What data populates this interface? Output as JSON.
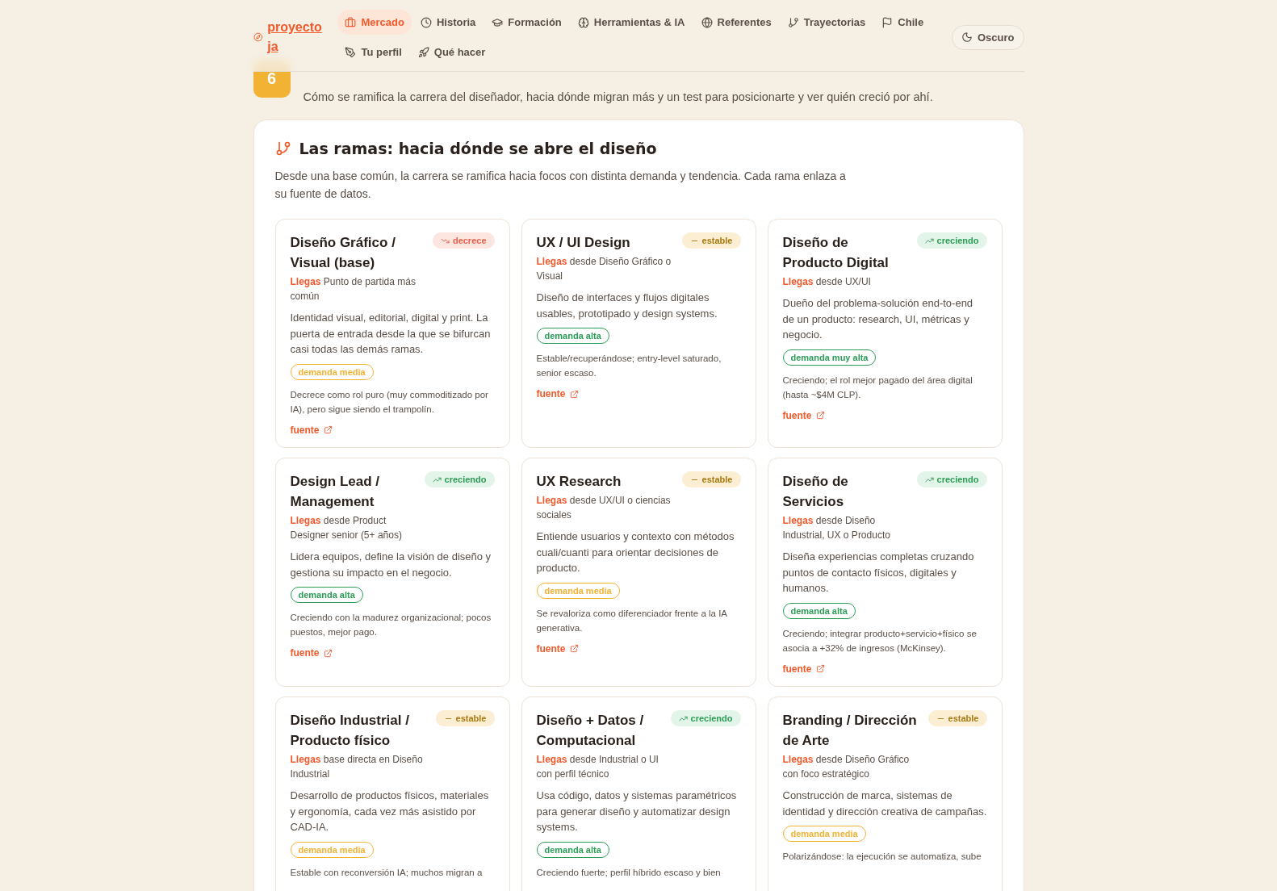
{
  "logo": {
    "text": "proyecto ja"
  },
  "nav": {
    "items": [
      {
        "label": "Mercado",
        "selected": true
      },
      {
        "label": "Historia",
        "selected": false
      },
      {
        "label": "Formación",
        "selected": false
      },
      {
        "label": "Herramientas & IA",
        "selected": false
      },
      {
        "label": "Referentes",
        "selected": false
      },
      {
        "label": "Trayectorias",
        "selected": false
      },
      {
        "label": "Chile",
        "selected": false
      },
      {
        "label": "Tu perfil",
        "selected": false
      },
      {
        "label": "Qué hacer",
        "selected": false
      }
    ],
    "theme_button": "Oscuro"
  },
  "section": {
    "number": "6",
    "subtitle": "Cómo se ramifica la carrera del diseñador, hacia dónde migran más y un test para posicionarte y ver quién creció por ahí."
  },
  "panel": {
    "title": "Las ramas: hacia dónde se abre el diseño",
    "description": "Desde una base común, la carrera se ramifica hacia focos con distinta demanda y tendencia. Cada rama enlaza a su fuente de datos.",
    "cards": [
      {
        "title": "Diseño Gráfico / Visual (base)",
        "trend": {
          "kind": "down",
          "label": "decrece"
        },
        "from_label": "Llegas",
        "from": "Punto de partida más común",
        "description": "Identidad visual, editorial, digital y print. La puerta de entrada desde la que se bifurcan casi todas las demás ramas.",
        "demand": {
          "kind": "medium",
          "label": "demanda media"
        },
        "note": "Decrece como rol puro (muy commoditizado por IA), pero sigue siendo el trampolín.",
        "link": "fuente"
      },
      {
        "title": "UX / UI Design",
        "trend": {
          "kind": "flat",
          "label": "estable"
        },
        "from_label": "Llegas",
        "from": "desde Diseño Gráfico o Visual",
        "description": "Diseño de interfaces y flujos digitales usables, prototipado y design systems.",
        "demand": {
          "kind": "high",
          "label": "demanda alta"
        },
        "note": "Estable/recuperándose; entry-level saturado, senior escaso.",
        "link": "fuente"
      },
      {
        "title": "Diseño de Producto Digital",
        "trend": {
          "kind": "up",
          "label": "creciendo"
        },
        "from_label": "Llegas",
        "from": "desde UX/UI",
        "description": "Dueño del problema-solución end-to-end de un producto: research, UI, métricas y negocio.",
        "demand": {
          "kind": "high",
          "label": "demanda muy alta"
        },
        "note": "Creciendo; el rol mejor pagado del área digital (hasta ~$4M CLP).",
        "link": "fuente"
      },
      {
        "title": "Design Lead / Management",
        "trend": {
          "kind": "up",
          "label": "creciendo"
        },
        "from_label": "Llegas",
        "from": "desde Product Designer senior (5+ años)",
        "description": "Lidera equipos, define la visión de diseño y gestiona su impacto en el negocio.",
        "demand": {
          "kind": "high",
          "label": "demanda alta"
        },
        "note": "Creciendo con la madurez organizacional; pocos puestos, mejor pago.",
        "link": "fuente"
      },
      {
        "title": "UX Research",
        "trend": {
          "kind": "flat",
          "label": "estable"
        },
        "from_label": "Llegas",
        "from": "desde UX/UI o ciencias sociales",
        "description": "Entiende usuarios y contexto con métodos cuali/cuanti para orientar decisiones de producto.",
        "demand": {
          "kind": "medium",
          "label": "demanda media"
        },
        "note": "Se revaloriza como diferenciador frente a la IA generativa.",
        "link": "fuente"
      },
      {
        "title": "Diseño de Servicios",
        "trend": {
          "kind": "up",
          "label": "creciendo"
        },
        "from_label": "Llegas",
        "from": "desde Diseño Industrial, UX o Producto",
        "description": "Diseña experiencias completas cruzando puntos de contacto físicos, digitales y humanos.",
        "demand": {
          "kind": "high",
          "label": "demanda alta"
        },
        "note": "Creciendo; integrar producto+servicio+físico se asocia a +32% de ingresos (McKinsey).",
        "link": "fuente"
      },
      {
        "title": "Diseño Industrial / Producto físico",
        "trend": {
          "kind": "flat",
          "label": "estable"
        },
        "from_label": "Llegas",
        "from": "base directa en Diseño Industrial",
        "description": "Desarrollo de productos físicos, materiales y ergonomía, cada vez más asistido por CAD-IA.",
        "demand": {
          "kind": "medium",
          "label": "demanda media"
        },
        "note": "Estable con reconversión IA; muchos migran a"
      },
      {
        "title": "Diseño + Datos / Computacional",
        "trend": {
          "kind": "up",
          "label": "creciendo"
        },
        "from_label": "Llegas",
        "from": "desde Industrial o UI con perfil técnico",
        "description": "Usa código, datos y sistemas paramétricos para generar diseño y automatizar design systems.",
        "demand": {
          "kind": "high",
          "label": "demanda alta"
        },
        "note": "Creciendo fuerte; perfil híbrido escaso y bien"
      },
      {
        "title": "Branding / Dirección de Arte",
        "trend": {
          "kind": "flat",
          "label": "estable"
        },
        "from_label": "Llegas",
        "from": "desde Diseño Gráfico con foco estratégico",
        "description": "Construcción de marca, sistemas de identidad y dirección creativa de campañas.",
        "demand": {
          "kind": "medium",
          "label": "demanda media"
        },
        "note": "Polarizándose: la ejecución se automatiza, sube"
      }
    ]
  }
}
